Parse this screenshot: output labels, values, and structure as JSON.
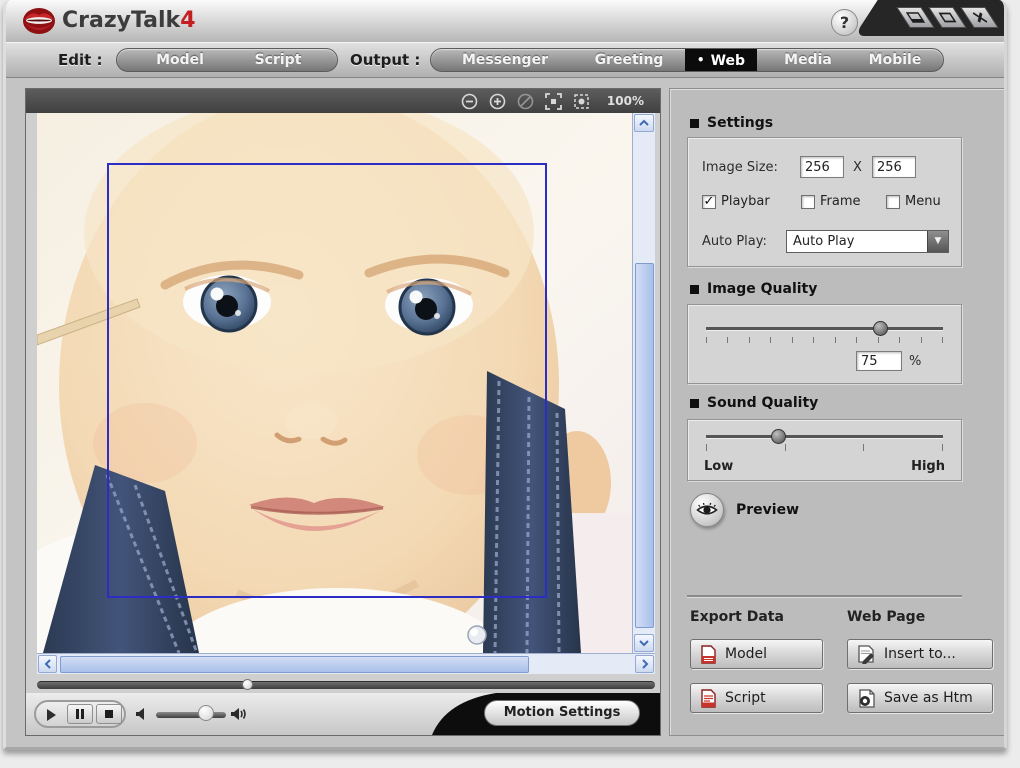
{
  "window": {
    "title_main": "CrazyTalk",
    "title_version": "4",
    "help_label": "?"
  },
  "toolbar": {
    "edit_label": "Edit :",
    "edit_items": [
      {
        "label": "Model"
      },
      {
        "label": "Script"
      }
    ],
    "output_label": "Output :",
    "output_items": [
      {
        "label": "Messenger",
        "selected": false
      },
      {
        "label": "Greeting",
        "selected": false
      },
      {
        "label": "Web",
        "selected": true,
        "bullet": "•"
      },
      {
        "label": "Media",
        "selected": false
      },
      {
        "label": "Mobile",
        "selected": false
      }
    ]
  },
  "viewer": {
    "zoom_level": "100%",
    "icons": [
      "zoom-out",
      "zoom-in",
      "zoom-disabled",
      "fit-window",
      "fit-face"
    ]
  },
  "playback": {
    "motion_settings_label": "Motion Settings"
  },
  "panel": {
    "settings": {
      "title": "Settings",
      "image_size_label": "Image Size:",
      "width_value": "256",
      "x_separator": "X",
      "height_value": "256",
      "checkboxes": [
        {
          "label": "Playbar",
          "checked": true,
          "mark": "✓"
        },
        {
          "label": "Frame",
          "checked": false,
          "mark": ""
        },
        {
          "label": "Menu",
          "checked": false,
          "mark": ""
        }
      ],
      "auto_play_label": "Auto Play:",
      "auto_play_value": "Auto Play",
      "dropdown_arrow": "▼"
    },
    "image_quality": {
      "title": "Image Quality",
      "value": "75",
      "unit": "%",
      "slider_percent": 73
    },
    "sound_quality": {
      "title": "Sound Quality",
      "low_label": "Low",
      "high_label": "High",
      "slider_percent": 30
    },
    "preview_label": "Preview",
    "export_data": {
      "title": "Export Data",
      "buttons": [
        "Model",
        "Script"
      ]
    },
    "web_page": {
      "title": "Web Page",
      "buttons": [
        "Insert to...",
        "Save as Htm"
      ]
    }
  },
  "colors": {
    "accent_red": "#c41e23",
    "selection_blue": "#2b2dc4",
    "scrollbar_blue": "#a9c0ea",
    "titleband_dark": "#262626",
    "panel_gray": "#bcbcbc"
  }
}
